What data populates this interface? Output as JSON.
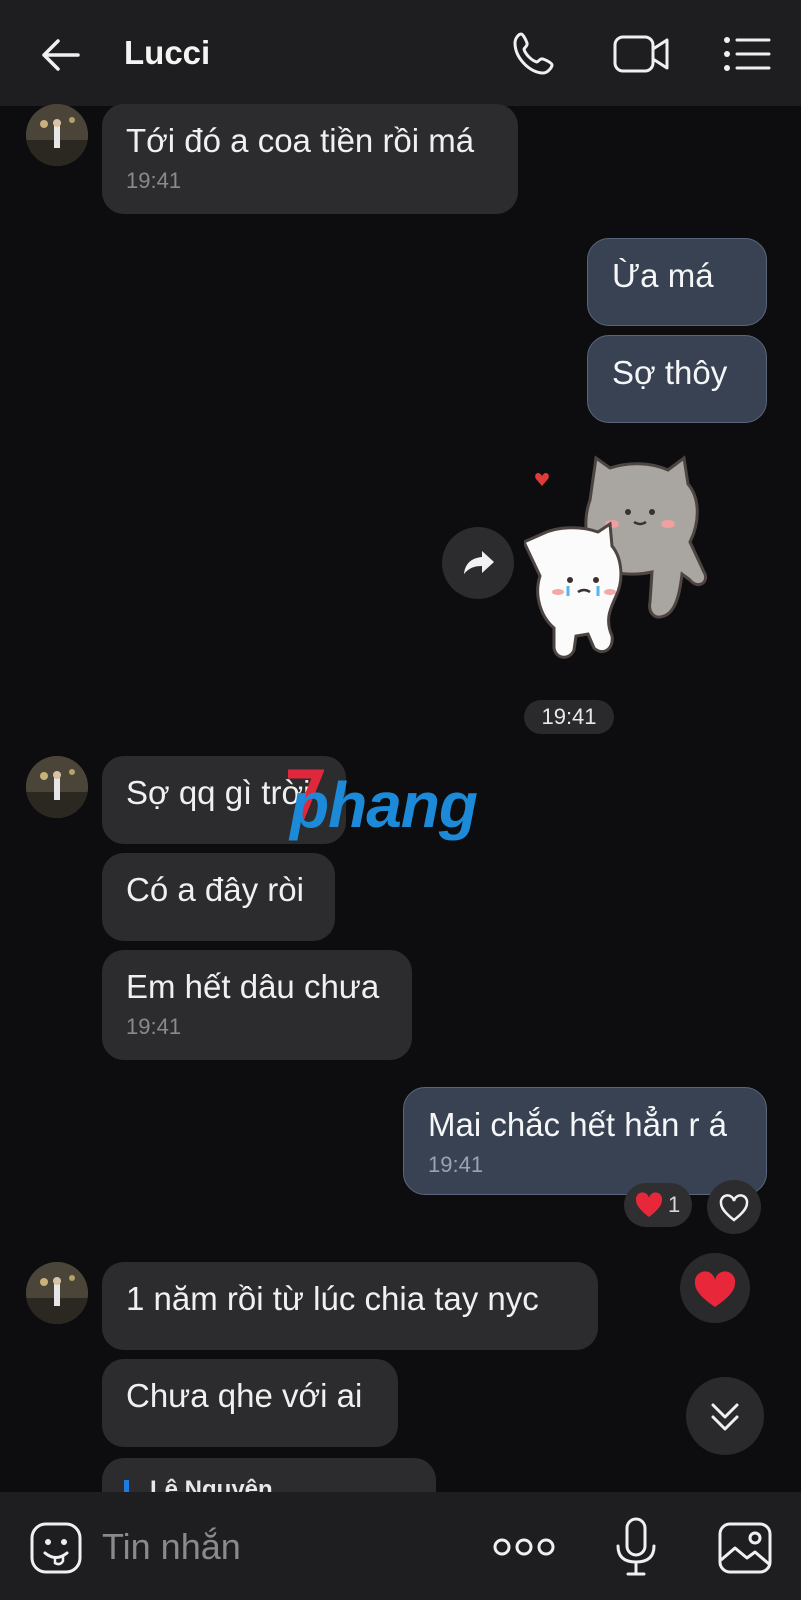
{
  "header": {
    "title": "Lucci",
    "back_icon": "arrow-left-icon",
    "call_icon": "phone-icon",
    "video_icon": "video-camera-icon",
    "menu_icon": "list-menu-icon"
  },
  "messages": [
    {
      "side": "in",
      "text": "Tới đó a coa tiền rồi má",
      "time": "19:41"
    },
    {
      "side": "out",
      "text": "Ừa má"
    },
    {
      "side": "out",
      "text": "Sợ thôy"
    },
    {
      "side": "out",
      "type": "sticker",
      "sticker": "cats-hug-sticker"
    },
    {
      "side": "in",
      "text": "Sợ qq gì trời"
    },
    {
      "side": "in",
      "text": "Có a đây ròi"
    },
    {
      "side": "in",
      "text": "Em hết dâu chưa",
      "time": "19:41"
    },
    {
      "side": "out",
      "text": "Mai chắc hết hẳn r á",
      "time": "19:41",
      "reaction": {
        "icon": "heart-icon",
        "count": "1"
      }
    },
    {
      "side": "in",
      "text": "1 năm rồi từ lúc chia tay nyc"
    },
    {
      "side": "in",
      "text": "Chưa qhe với ai"
    }
  ],
  "sticker_time": "19:41",
  "quoted_preview": {
    "name": "Lê Nguyên"
  },
  "watermark": {
    "text": "phang"
  },
  "composer": {
    "placeholder": "Tin nhắn",
    "emoji_icon": "emoji-sticker-icon",
    "more_icon": "more-dots-icon",
    "mic_icon": "microphone-icon",
    "gallery_icon": "image-gallery-icon"
  },
  "colors": {
    "background": "#0d0d0f",
    "incoming_bubble": "#2c2c2e",
    "outgoing_bubble": "#384252",
    "reaction_red": "#e8283a"
  }
}
